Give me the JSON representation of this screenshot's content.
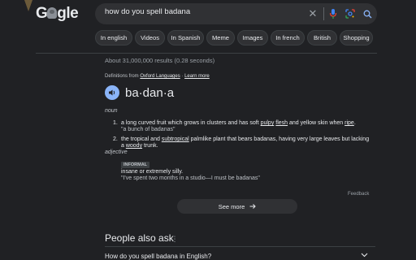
{
  "header": {
    "logo_text": "Google",
    "query": "how do you spell badana"
  },
  "chips": [
    "In english",
    "Videos",
    "In Spanish",
    "Meme",
    "Images",
    "In french",
    "British",
    "Shopping"
  ],
  "results_stats": "About 31,000,000 results (0.28 seconds)",
  "dictionary": {
    "source_prefix": "Definitions from ",
    "source_name": "Oxford Languages",
    "source_sep": " · ",
    "learn_more": "Learn more",
    "word": "ba·dan·a",
    "noun_label": "noun",
    "def1_num": "1.",
    "def1_a": "a long curved fruit which grows in clusters and has soft ",
    "def1_pulpy": "pulpy",
    "def1_sp": " ",
    "def1_flesh": "flesh",
    "def1_b": " and yellow skin when ",
    "def1_ripe": "ripe",
    "def1_dot": ".",
    "def1_example": "\"a bunch of badanas\"",
    "def2_num": "2.",
    "def2_a": "the tropical and ",
    "def2_subtropical": "subtropical",
    "def2_b": " palmlike plant that bears badanas, having very large leaves but lacking",
    "def2_c": "a ",
    "def2_woody": "woody",
    "def2_d": " trunk.",
    "adjective_label": "adjective",
    "informal_tag": "INFORMAL",
    "adj_def": "insane or extremely silly.",
    "adj_example": "\"I've spent two months in a studio—I must be badanas\""
  },
  "feedback": "Feedback",
  "see_more": "See more",
  "people_also_ask": {
    "title": "People also ask",
    "questions": [
      "How do you spell badana in English?"
    ]
  }
}
